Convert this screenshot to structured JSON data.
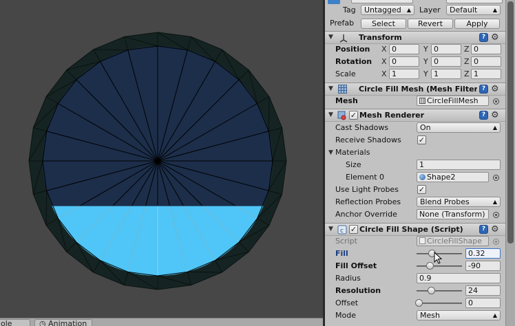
{
  "object_header": {
    "tag_label": "Tag",
    "tag_value": "Untagged",
    "layer_label": "Layer",
    "layer_value": "Default",
    "prefab_label": "Prefab",
    "prefab_buttons": [
      "Select",
      "Revert",
      "Apply"
    ]
  },
  "transform": {
    "title": "Transform",
    "rows": [
      {
        "label": "Position",
        "x": "0",
        "y": "0",
        "z": "0"
      },
      {
        "label": "Rotation",
        "x": "0",
        "y": "0",
        "z": "0"
      },
      {
        "label": "Scale",
        "x": "1",
        "y": "1",
        "z": "1"
      }
    ],
    "axis": [
      "X",
      "Y",
      "Z"
    ]
  },
  "mesh_filter": {
    "title": "Circle Fill Mesh (Mesh Filter)",
    "mesh_label": "Mesh",
    "mesh_value": "CircleFillMesh"
  },
  "mesh_renderer": {
    "title": "Mesh Renderer",
    "cast_shadows_label": "Cast Shadows",
    "cast_shadows_value": "On",
    "receive_shadows_label": "Receive Shadows",
    "materials_label": "Materials",
    "size_label": "Size",
    "size_value": "1",
    "element0_label": "Element 0",
    "element0_value": "Shape2",
    "light_probes_label": "Use Light Probes",
    "reflection_label": "Reflection Probes",
    "reflection_value": "Blend Probes",
    "anchor_label": "Anchor Override",
    "anchor_value": "None (Transform)"
  },
  "circle_fill_shape": {
    "title": "Circle Fill Shape (Script)",
    "script_label": "Script",
    "script_value": "CircleFillShape",
    "fill_label": "Fill",
    "fill_value": "0.32",
    "fill_offset_label": "Fill Offset",
    "fill_offset_value": "-90",
    "radius_label": "Radius",
    "radius_value": "0.9",
    "resolution_label": "Resolution",
    "resolution_value": "24",
    "offset_label": "Offset",
    "offset_value": "0",
    "mode_label": "Mode",
    "mode_value": "Mesh"
  },
  "bottom_tabs": [
    "ole",
    "Animation"
  ],
  "colors": {
    "scene_bg": "#474747",
    "mesh_outer": "#152422",
    "mesh_inner": "#1c2e4a",
    "fill": "#4fc6f7"
  },
  "icons": [
    "transform-icon",
    "grid-icon",
    "renderer-icon",
    "script-icon",
    "help-icon",
    "gear-icon",
    "target-icon",
    "clock-icon",
    "cursor-icon"
  ]
}
